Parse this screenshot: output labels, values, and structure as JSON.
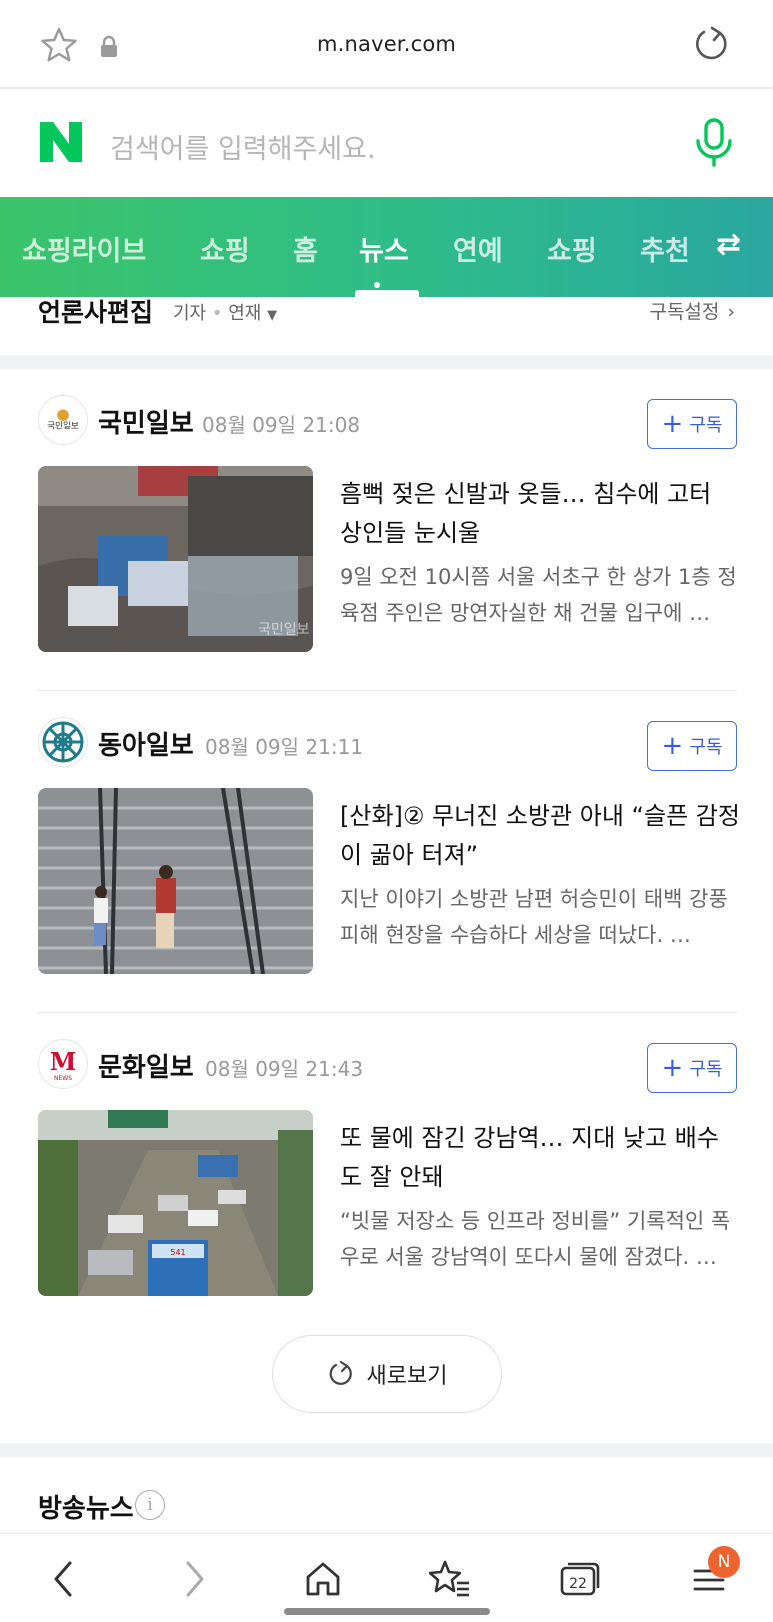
{
  "browser": {
    "url": "m.naver.com"
  },
  "search": {
    "placeholder": "검색어를 입력해주세요."
  },
  "tabs": [
    {
      "label": "쇼핑라이브"
    },
    {
      "label": "쇼핑"
    },
    {
      "label": "홈"
    },
    {
      "label": "뉴스",
      "active": true
    },
    {
      "label": "연예"
    },
    {
      "label": "쇼핑"
    },
    {
      "label": "추천"
    }
  ],
  "section": {
    "title": "언론사편집",
    "sub_reporter": "기자",
    "sub_series": "연재",
    "settings": "구독설정"
  },
  "subscribe_label": "구독",
  "articles": [
    {
      "press": "국민일보",
      "time": "08월 09일 21:08",
      "headline": "흠뻑 젖은 신발과 옷들… 침수에 고터 상인들 눈시울",
      "summary": "9일 오전 10시쯤 서울 서초구 한 상가 1층 정육점 주인은 망연자실한 채 건물 입구에 …",
      "logo_text": "국민일보",
      "watermark": "국민일보"
    },
    {
      "press": "동아일보",
      "time": "08월 09일 21:11",
      "headline": "[산화]② 무너진 소방관 아내 “슬픈 감정이 곪아 터져”",
      "summary": "지난 이야기 소방관 남편 허승민이 태백 강풍 피해 현장을 수습하다 세상을 떠났다. …"
    },
    {
      "press": "문화일보",
      "time": "08월 09일 21:43",
      "headline": "또 물에 잠긴 강남역… 지대 낮고 배수도 잘 안돼",
      "summary": "“빗물 저장소 등 인프라 정비를” 기록적인 폭우로 서울 강남역이 또다시 물에 잠겼다. …",
      "logo_text": "M",
      "logo_sub": "NEWS",
      "bus_number": "541"
    }
  ],
  "refresh_label": "새로보기",
  "broadcast": {
    "title": "방송뉴스",
    "info": "i"
  },
  "bottom_nav": {
    "tabs_count": "22",
    "badge": "N"
  },
  "colors": {
    "naver_green": "#03c75a",
    "subscribe_blue": "#3a5fc8",
    "badge_orange": "#f0632e"
  }
}
